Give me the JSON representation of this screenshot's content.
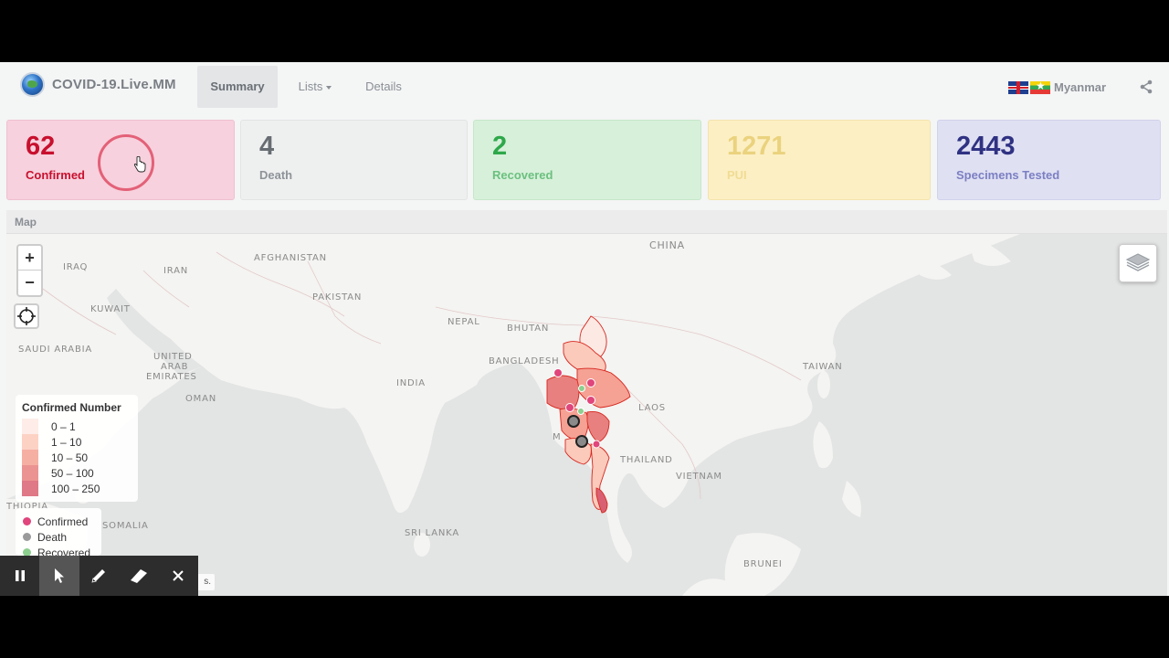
{
  "app": {
    "brand": "COVID-19.Live.MM",
    "tabs": [
      {
        "label": "Summary",
        "active": true
      },
      {
        "label": "Lists",
        "dropdown": true
      },
      {
        "label": "Details"
      }
    ],
    "language": "Myanmar",
    "icons": {
      "share": "share-icon",
      "language_flags": [
        "uk-flag-icon",
        "myanmar-flag-icon"
      ]
    }
  },
  "stats": {
    "confirmed": {
      "value": "62",
      "label": "Confirmed",
      "color": "#c8102e"
    },
    "death": {
      "value": "4",
      "label": "Death",
      "color": "#676d72"
    },
    "recovered": {
      "value": "2",
      "label": "Recovered",
      "color": "#2ea84a"
    },
    "pui": {
      "value": "1271",
      "label": "PUI",
      "color": "#ead27e"
    },
    "specimens": {
      "value": "2443",
      "label": "Specimens Tested",
      "color": "#2f3282"
    }
  },
  "map": {
    "section_title": "Map",
    "zoom_in": "+",
    "zoom_out": "−",
    "attribution": "s.",
    "country_labels": [
      "CHINA",
      "IRAQ",
      "IRAN",
      "AFGHANISTAN",
      "PAKISTAN",
      "KUWAIT",
      "NEPAL",
      "BHUTAN",
      "SAUDI ARABIA",
      "UNITED",
      "ARAB",
      "EMIRATES",
      "BANGLADESH",
      "INDIA",
      "OMAN",
      "LAOS",
      "TAIWAN",
      "M",
      "THAILAND",
      "VIETNAM",
      "THIOPIA",
      "SOMALIA",
      "SRI LANKA",
      "BRUNEI"
    ],
    "choropleth_legend": {
      "title": "Confirmed Number",
      "ranges": [
        {
          "label": "0 – 1",
          "color": "#fde9e3"
        },
        {
          "label": "1 – 10",
          "color": "#fbcabb"
        },
        {
          "label": "10 – 50",
          "color": "#f5a193"
        },
        {
          "label": "50 – 100",
          "color": "#e8807f"
        },
        {
          "label": "100 – 250",
          "color": "#d96072"
        }
      ]
    },
    "marker_legend": [
      {
        "label": "Confirmed",
        "color": "#e0457b"
      },
      {
        "label": "Death",
        "color": "#9a9a9a"
      },
      {
        "label": "Recovered",
        "color": "#8dcf8f"
      }
    ]
  },
  "toolbar": {
    "tools": [
      "pause-icon",
      "pointer-icon",
      "pen-icon",
      "eraser-icon",
      "close-icon"
    ]
  }
}
